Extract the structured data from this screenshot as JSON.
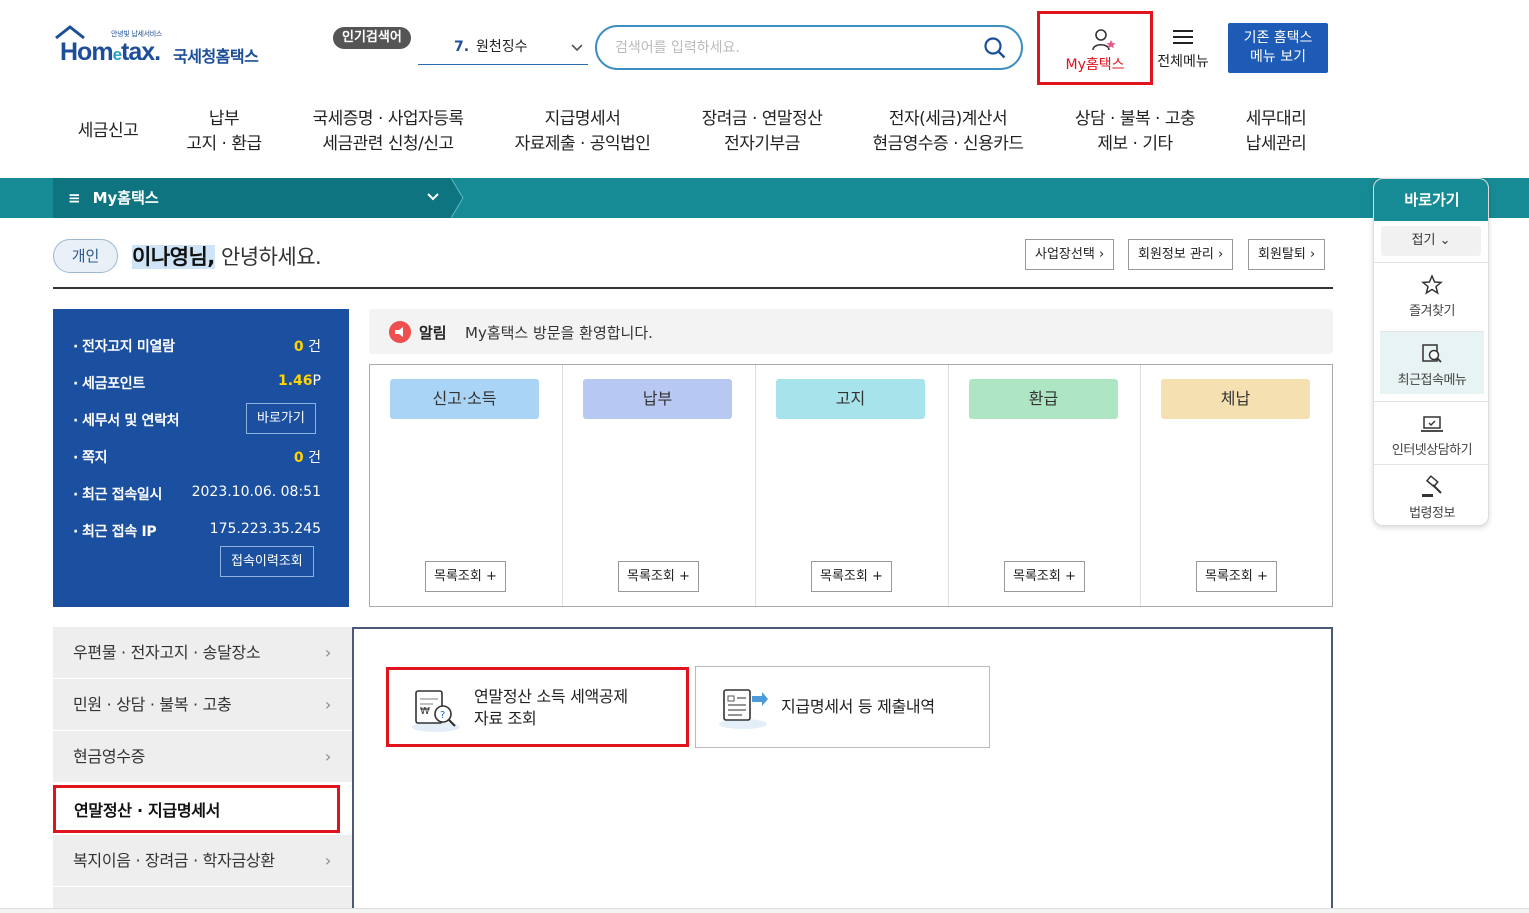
{
  "header": {
    "logo_sub": "안녕빛 납세서비스",
    "logo_main_1": "Hom",
    "logo_main_e": "e",
    "logo_main_2": "tax.",
    "logo_kr": "국세청홈택스",
    "popular_badge": "인기검색어",
    "popular_num": "7.",
    "popular_text": "원천징수",
    "search_placeholder": "검색어를 입력하세요.",
    "my_hometax": "My홈택스",
    "all_menu": "전체메뉴",
    "old_menu_line1": "기존 홈택스",
    "old_menu_line2": "메뉴 보기"
  },
  "gnb": [
    {
      "line1": "세금신고",
      "line2": ""
    },
    {
      "line1": "납부",
      "line2": "고지 · 환급"
    },
    {
      "line1": "국세증명 · 사업자등록",
      "line2": "세금관련 신청/신고"
    },
    {
      "line1": "지급명세서",
      "line2": "자료제출 · 공익법인"
    },
    {
      "line1": "장려금 · 연말정산",
      "line2": "전자기부금"
    },
    {
      "line1": "전자(세금)계산서",
      "line2": "현금영수증 · 신용카드"
    },
    {
      "line1": "상담 · 불복 · 고충",
      "line2": "제보 · 기타"
    },
    {
      "line1": "세무대리",
      "line2": "납세관리"
    }
  ],
  "breadcrumb": {
    "menu_glyph": "≡",
    "title": "My홈택스"
  },
  "greeting": {
    "type_pill": "개인",
    "name": "이나영님,",
    "text": " 안녕하세요.",
    "buttons": [
      "사업장선택",
      "회원정보 관리",
      "회원탈퇴"
    ]
  },
  "info_panel": {
    "rows": [
      {
        "label": "전자고지 미열람",
        "value": "0",
        "unit": "건"
      },
      {
        "label": "세금포인트",
        "value": "1.46",
        "unit": "P"
      },
      {
        "label": "세무서 및 연락처",
        "button": "바로가기"
      },
      {
        "label": "쪽지",
        "value": "0",
        "unit": "건"
      },
      {
        "label": "최근 접속일시",
        "text": "2023.10.06.  08:51"
      },
      {
        "label": "최근 접속 IP",
        "text": "175.223.35.245"
      }
    ],
    "history_button": "접속이력조회"
  },
  "notice": {
    "label": "알림",
    "message": "My홈택스 방문을 환영합니다."
  },
  "categories": [
    {
      "label": "신고·소득",
      "color": "#a9d4f5",
      "button": "목록조회 +"
    },
    {
      "label": "납부",
      "color": "#b7c8f2",
      "button": "목록조회 +"
    },
    {
      "label": "고지",
      "color": "#a6e3ea",
      "button": "목록조회 +"
    },
    {
      "label": "환급",
      "color": "#aee5c3",
      "button": "목록조회 +"
    },
    {
      "label": "체납",
      "color": "#f5e0b2",
      "button": "목록조회 +"
    }
  ],
  "side_menu": [
    {
      "label": "우편물 · 전자고지 · 송달장소"
    },
    {
      "label": "민원 · 상담 · 불복 · 고충"
    },
    {
      "label": "현금영수증"
    },
    {
      "label": "연말정산 · 지급명세서"
    },
    {
      "label": "복지이음 · 장려금 · 학자금상환"
    }
  ],
  "side_arrow": "›",
  "cards": [
    {
      "line1": "연말정산 소득 세액공제",
      "line2": "자료 조회"
    },
    {
      "line1": "지급명세서 등 제출내역",
      "line2": ""
    }
  ],
  "quick": {
    "title": "바로가기",
    "fold": "접기 ⌄",
    "items": [
      "즐겨찾기",
      "최근접속메뉴",
      "인터넷상담하기",
      "법령정보"
    ]
  },
  "colors": {
    "teal": "#178b95",
    "navy": "#1b4fa0",
    "highlight_red": "#e0141f",
    "point_yellow": "#ffd400"
  }
}
